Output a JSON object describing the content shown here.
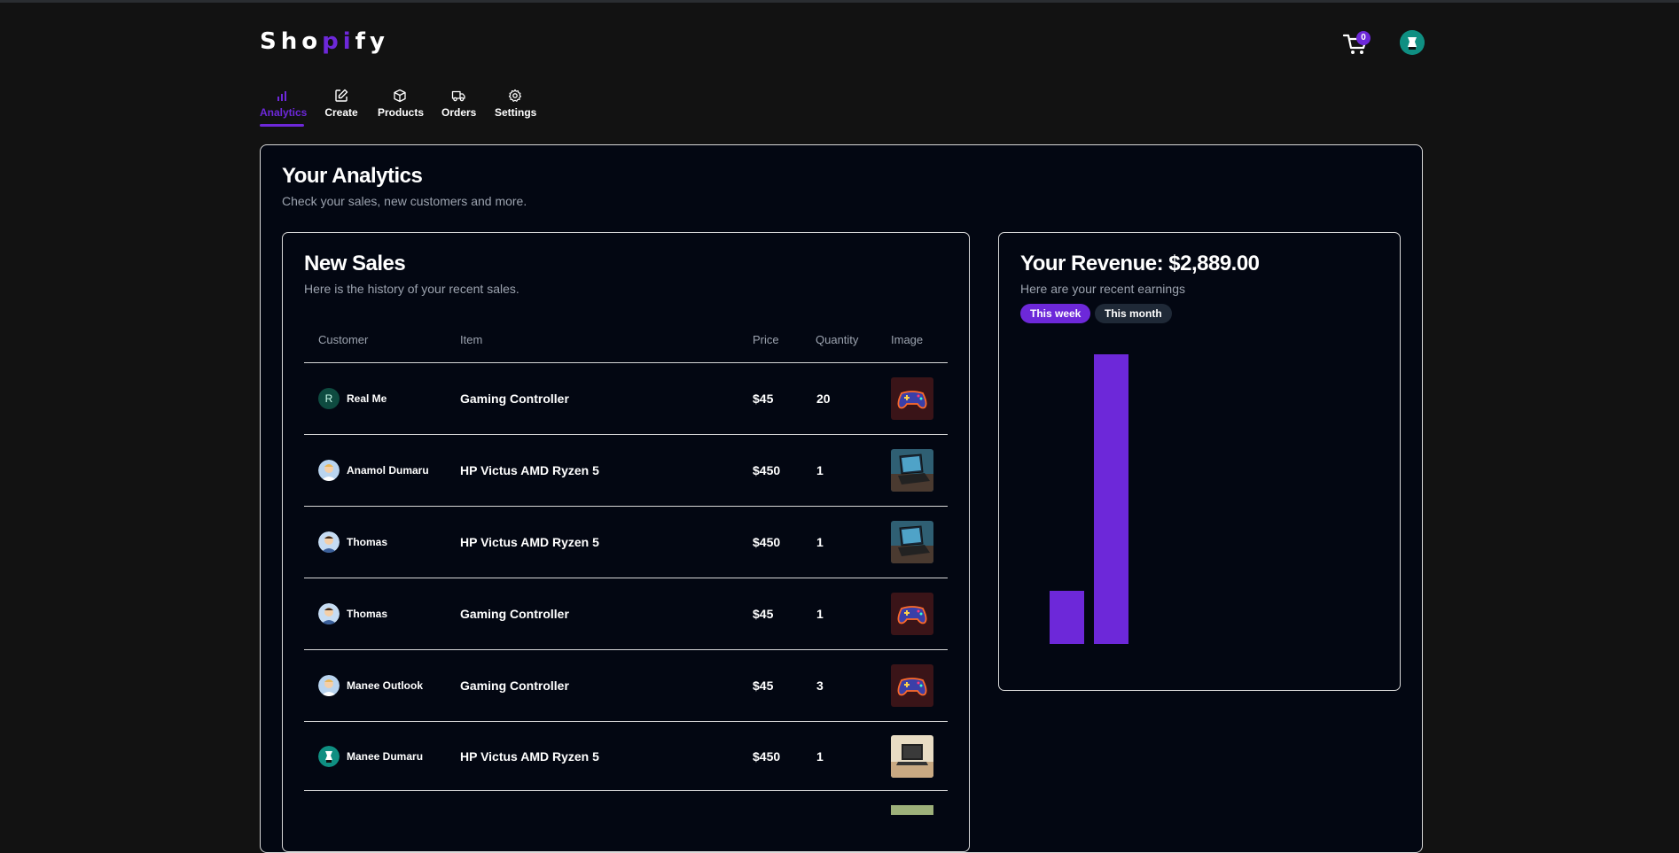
{
  "app": {
    "logo": {
      "pre": "Sho",
      "accent": "pi",
      "post": "fy"
    },
    "cart_count": "0"
  },
  "nav": [
    {
      "label": "Analytics",
      "icon": "bar-chart-icon",
      "active": true
    },
    {
      "label": "Create",
      "icon": "edit-icon",
      "active": false
    },
    {
      "label": "Products",
      "icon": "box-icon",
      "active": false
    },
    {
      "label": "Orders",
      "icon": "truck-icon",
      "active": false
    },
    {
      "label": "Settings",
      "icon": "gear-icon",
      "active": false
    }
  ],
  "page": {
    "title": "Your Analytics",
    "subtitle": "Check your sales, new customers and more."
  },
  "sales": {
    "title": "New Sales",
    "subtitle": "Here is the history of your recent sales.",
    "columns": [
      "Customer",
      "Item",
      "Price",
      "Quantity",
      "Image"
    ],
    "rows": [
      {
        "customer": "Real Me",
        "avatar": "letter",
        "avatar_letter": "R",
        "item": "Gaming Controller",
        "price": "$45",
        "quantity": "20",
        "image": "gaming-controller"
      },
      {
        "customer": "Anamol Dumaru",
        "avatar": "person",
        "item": "HP Victus AMD Ryzen 5",
        "price": "$450",
        "quantity": "1",
        "image": "laptop"
      },
      {
        "customer": "Thomas",
        "avatar": "person",
        "item": "HP Victus AMD Ryzen 5",
        "price": "$450",
        "quantity": "1",
        "image": "laptop"
      },
      {
        "customer": "Thomas",
        "avatar": "person",
        "item": "Gaming Controller",
        "price": "$45",
        "quantity": "1",
        "image": "gaming-controller"
      },
      {
        "customer": "Manee Outlook",
        "avatar": "person",
        "item": "Gaming Controller",
        "price": "$45",
        "quantity": "3",
        "image": "gaming-controller"
      },
      {
        "customer": "Manee Dumaru",
        "avatar": "teal-person",
        "item": "HP Victus AMD Ryzen 5",
        "price": "$450",
        "quantity": "1",
        "image": "laptop-desk"
      }
    ]
  },
  "revenue": {
    "title": "Your Revenue: $2,889.00",
    "subtitle": "Here are your recent earnings",
    "filters": [
      "This week",
      "This month"
    ],
    "active_filter": "This week",
    "color": "#6d28d9"
  },
  "chart_data": {
    "type": "bar",
    "categories": [
      "",
      ""
    ],
    "values": [
      448,
      2441
    ],
    "title": "",
    "xlabel": "",
    "ylabel": "",
    "ylim": [
      0,
      2441
    ]
  },
  "colors": {
    "accent": "#6d28d9",
    "background": "#121212",
    "card": "#030712"
  }
}
